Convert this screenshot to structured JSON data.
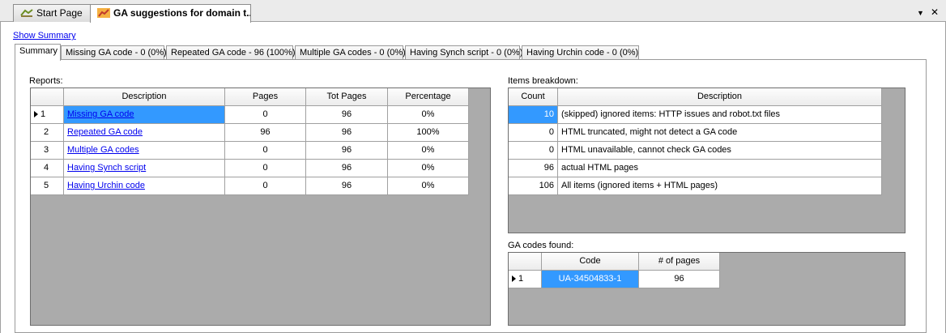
{
  "doc_tabs": {
    "start_page": "Start Page",
    "ga_tab": "GA suggestions for domain t..."
  },
  "window_controls": {
    "dropdown": "▼",
    "close": "✕"
  },
  "show_summary": "Show Summary",
  "tabs": [
    "Summary",
    "Missing GA code - 0 (0%)",
    "Repeated GA code - 96 (100%)",
    "Multiple GA codes - 0 (0%)",
    "Having Synch script - 0 (0%)",
    "Having Urchin code - 0 (0%)"
  ],
  "reports": {
    "label": "Reports:",
    "headers": [
      "Description",
      "Pages",
      "Tot Pages",
      "Percentage"
    ],
    "rows": [
      {
        "num": "1",
        "description": "Missing GA code",
        "pages": "0",
        "tot_pages": "96",
        "percentage": "0%"
      },
      {
        "num": "2",
        "description": "Repeated GA code",
        "pages": "96",
        "tot_pages": "96",
        "percentage": "100%"
      },
      {
        "num": "3",
        "description": "Multiple GA codes",
        "pages": "0",
        "tot_pages": "96",
        "percentage": "0%"
      },
      {
        "num": "4",
        "description": "Having Synch script",
        "pages": "0",
        "tot_pages": "96",
        "percentage": "0%"
      },
      {
        "num": "5",
        "description": "Having Urchin code",
        "pages": "0",
        "tot_pages": "96",
        "percentage": "0%"
      }
    ]
  },
  "breakdown": {
    "label": "Items breakdown:",
    "headers": [
      "Count",
      "Description"
    ],
    "rows": [
      {
        "count": "10",
        "description": "(skipped) ignored items: HTTP issues and robot.txt files"
      },
      {
        "count": "0",
        "description": "HTML truncated, might not detect a GA code"
      },
      {
        "count": "0",
        "description": "HTML unavailable, cannot check GA codes"
      },
      {
        "count": "96",
        "description": "actual HTML pages"
      },
      {
        "count": "106",
        "description": "All items (ignored items + HTML pages)"
      }
    ]
  },
  "ga_codes": {
    "label": "GA codes found:",
    "headers": [
      "Code",
      "# of pages"
    ],
    "rows": [
      {
        "num": "1",
        "code": "UA-34504833-1",
        "pages": "96"
      }
    ]
  },
  "colors": {
    "selection": "#3399ff",
    "grid_background": "#ababab",
    "link": "#0000ee"
  }
}
